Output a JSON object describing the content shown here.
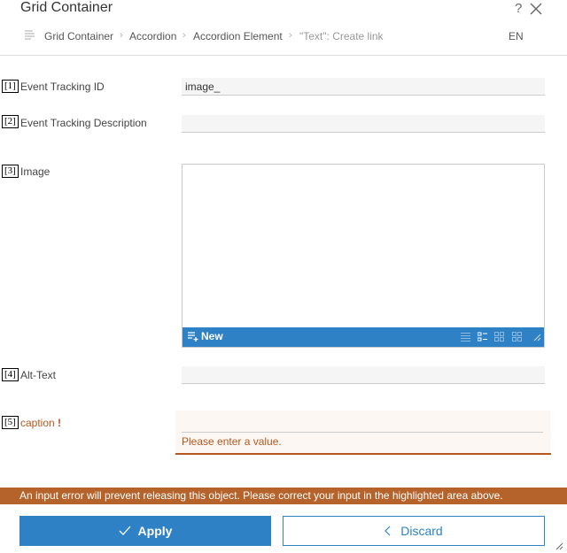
{
  "window": {
    "title": "Grid Container",
    "help_icon": "?",
    "close_icon": "close-icon"
  },
  "breadcrumb": {
    "items": [
      "Grid Container",
      "Accordion",
      "Accordion Element",
      "\"Text\": Create link"
    ],
    "separator": "›",
    "language": "EN"
  },
  "fields": {
    "event_tracking_id": {
      "number": "[1]",
      "label": "Event Tracking ID",
      "value": "image_"
    },
    "event_tracking_description": {
      "number": "[2]",
      "label": "Event Tracking Description",
      "value": ""
    },
    "image": {
      "number": "[3]",
      "label": "Image",
      "new_label": "New"
    },
    "alt_text": {
      "number": "[4]",
      "label": "Alt-Text",
      "value": ""
    },
    "caption": {
      "number": "[5]",
      "label": "caption",
      "required_mark": "!",
      "error": "Please enter a value."
    }
  },
  "error_banner": "An input error will prevent releasing this object. Please correct your input in the highlighted area above.",
  "actions": {
    "apply_label": "Apply",
    "discard_label": "Discard"
  },
  "colors": {
    "accent": "#2e81c4",
    "error": "#b5581f",
    "banner": "#b5632a"
  }
}
